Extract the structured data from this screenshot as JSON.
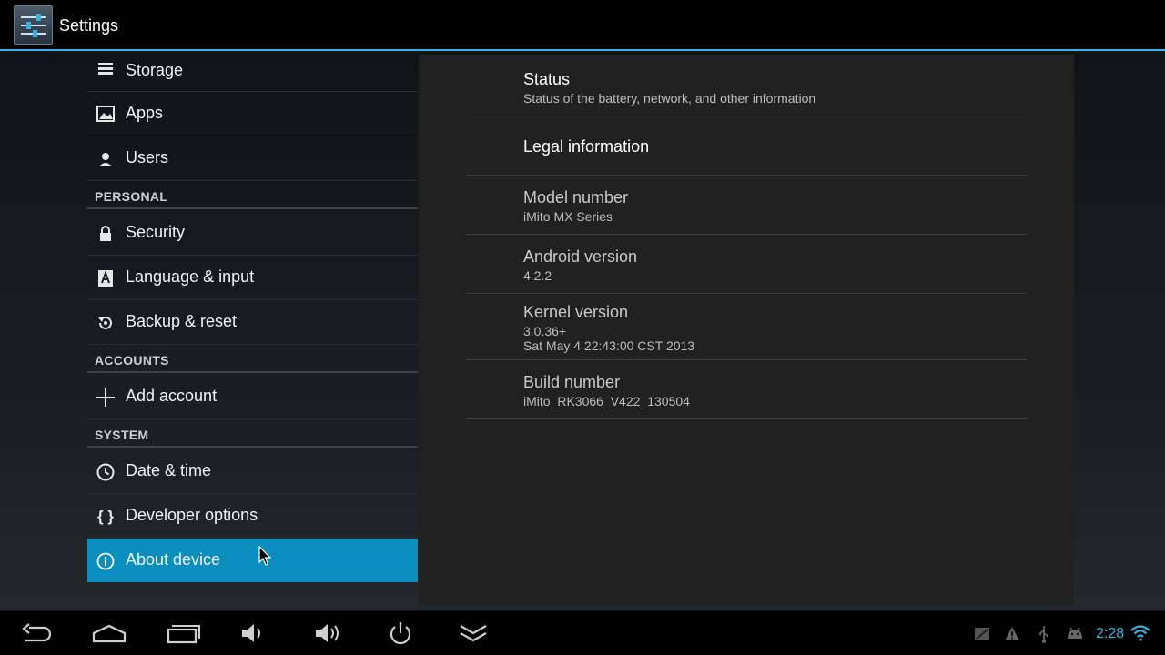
{
  "app": {
    "title": "Settings"
  },
  "sidebar": {
    "items_top": [
      {
        "label": "Storage",
        "icon": "storage-icon"
      },
      {
        "label": "Apps",
        "icon": "apps-icon"
      },
      {
        "label": "Users",
        "icon": "users-icon"
      }
    ],
    "personal_header": "PERSONAL",
    "personal": [
      {
        "label": "Security",
        "icon": "lock-icon"
      },
      {
        "label": "Language & input",
        "icon": "language-icon"
      },
      {
        "label": "Backup & reset",
        "icon": "backup-icon"
      }
    ],
    "accounts_header": "ACCOUNTS",
    "accounts": [
      {
        "label": "Add account",
        "icon": "plus-icon"
      }
    ],
    "system_header": "SYSTEM",
    "system": [
      {
        "label": "Date & time",
        "icon": "clock-icon"
      },
      {
        "label": "Developer options",
        "icon": "braces-icon",
        "glyph": "{ }"
      },
      {
        "label": "About device",
        "icon": "info-icon",
        "selected": true
      }
    ]
  },
  "about": {
    "status": {
      "title": "Status",
      "summary": "Status of the battery, network, and other information"
    },
    "legal": {
      "title": "Legal information"
    },
    "model": {
      "title": "Model number",
      "value": "iMito MX Series"
    },
    "android": {
      "title": "Android version",
      "value": "4.2.2"
    },
    "kernel": {
      "title": "Kernel version",
      "value_line1": "3.0.36+",
      "value_line2": "Sat May 4 22:43:00 CST 2013"
    },
    "build": {
      "title": "Build number",
      "value": "iMito_RK3066_V422_130504"
    }
  },
  "navbar": {
    "buttons": [
      "back-icon",
      "home-icon",
      "recents-icon",
      "volume-down-icon",
      "volume-up-icon",
      "power-icon",
      "collapse-icon"
    ],
    "status_icons": [
      "screenshot-icon",
      "warning-icon",
      "usb-icon",
      "android-debug-icon",
      "wifi-icon"
    ],
    "clock": "2:28"
  },
  "colors": {
    "accent": "#33b5e5",
    "selected": "#0a8ec0"
  }
}
